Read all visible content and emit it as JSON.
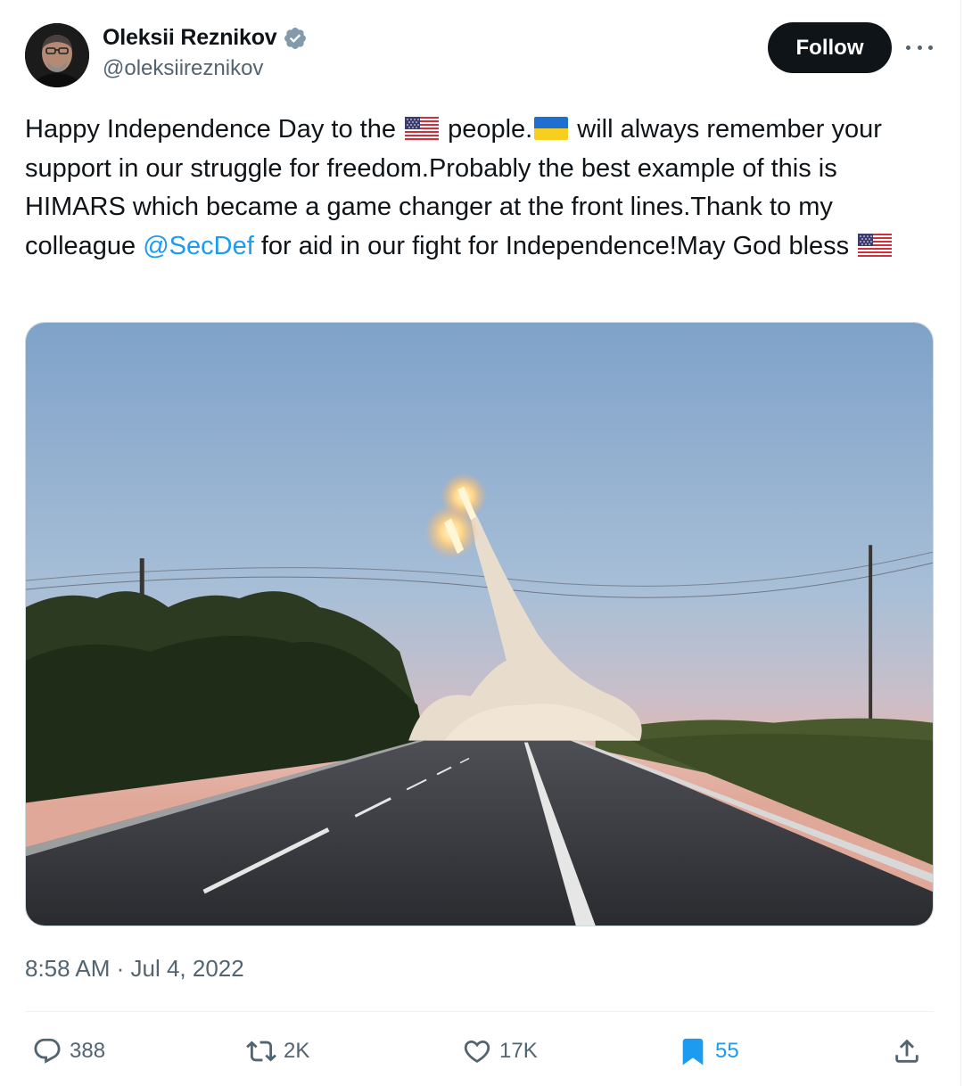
{
  "author": {
    "name": "Oleksii Reznikov",
    "handle": "@oleksiireznikov",
    "verified": true
  },
  "follow_label": "Follow",
  "tweet": {
    "segments": [
      {
        "type": "text",
        "value": "Happy Independence Day to the "
      },
      {
        "type": "flag",
        "value": "us-flag"
      },
      {
        "type": "text",
        "value": " people."
      },
      {
        "type": "flag",
        "value": "ukraine-flag"
      },
      {
        "type": "text",
        "value": " will always remember your support in our struggle for freedom.Probably the best example of this is HIMARS which became a game changer at the front lines.Thank to my colleague "
      },
      {
        "type": "mention",
        "value": "@SecDef"
      },
      {
        "type": "text",
        "value": " for aid in our fight for Independence!May God bless "
      },
      {
        "type": "flag",
        "value": "us-flag"
      }
    ]
  },
  "timestamp": "8:58 AM · Jul 4, 2022",
  "actions": {
    "replies": "388",
    "retweets": "2K",
    "likes": "17K",
    "bookmarks": "55"
  },
  "colors": {
    "accent": "#1d9bf0",
    "text": "#0f1419",
    "secondary": "#536471",
    "button_bg": "#0f1419"
  }
}
